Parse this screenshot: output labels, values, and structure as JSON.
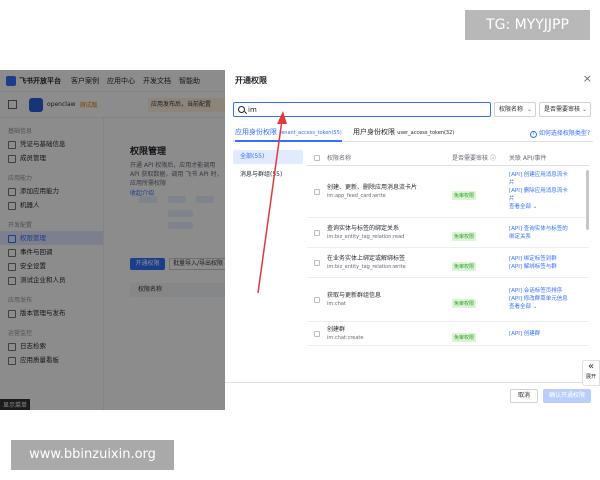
{
  "watermark_top": "TG: MYYJJPP",
  "watermark_bottom": "www.bbinzuixin.org",
  "bg": {
    "brand": "飞书开放平台",
    "nav": [
      "客户案例",
      "应用中心",
      "开发文档",
      "智能助"
    ],
    "app_name": "openclaw",
    "app_tag": "测试版",
    "warn": "应用发布后，当前配置",
    "side_groups": [
      {
        "title": "基础信息",
        "items": [
          "凭证与基础信息",
          "成员管理"
        ]
      },
      {
        "title": "应用能力",
        "items": [
          "添加应用能力",
          "机器人"
        ]
      },
      {
        "title": "开发配置",
        "items": [
          "权限管理",
          "事件与回调",
          "安全设置",
          "测试企业和人员"
        ]
      },
      {
        "title": "应用发布",
        "items": [
          "版本管理与发布"
        ]
      },
      {
        "title": "运营监控",
        "items": [
          "日志检索",
          "应用质量看板"
        ]
      }
    ],
    "active_item": "权限管理",
    "main_title": "权限管理",
    "main_desc": "开通 API 权限后，应用才能调用 API 获取数据，调用 飞书 API 时，应用所需权限",
    "main_link": "收起介绍",
    "main_btn": "开通权限",
    "main_btn2": "批量导入/导出权限",
    "table_header": "权限名称",
    "footer_badge": "显示菜单"
  },
  "modal": {
    "title": "开通权限",
    "search_value": "im",
    "select1": "权限名称",
    "select2": "是否需要审核",
    "tabs": [
      {
        "label": "应用身份权限",
        "sub": "tenant_access_token(55)",
        "active": true
      },
      {
        "label": "用户身份权限",
        "sub": "user_access_token(32)",
        "active": false
      }
    ],
    "help": "如何选择权限类型?",
    "categories": [
      {
        "label": "全部(55)",
        "active": true
      },
      {
        "label": "消息与群组(55)",
        "active": false
      }
    ],
    "columns": [
      "权限名称",
      "是否需要审核",
      "关联 API/事件"
    ],
    "rows": [
      {
        "name": "创建、更新、删除应用消息流卡片",
        "code": "im:app_feed_card:write",
        "review": "免审权限",
        "events": [
          "[API] 创建应用消息流卡",
          "片",
          "[API] 删除应用消息流卡",
          "片"
        ],
        "more": "查看全部"
      },
      {
        "name": "查询实体与标签的绑定关系",
        "code": "im:biz_entity_tag_relation:read",
        "review": "免审权限",
        "events": [
          "[API] 查询实体与标签的",
          "绑定关系"
        ],
        "more": ""
      },
      {
        "name": "在业务实体上绑定或解绑标签",
        "code": "im:biz_entity_tag_relation:write",
        "review": "免审权限",
        "events": [
          "[API] 绑定标签到群",
          "[API] 解绑标签与群"
        ],
        "more": ""
      },
      {
        "name": "获取与更新群组信息",
        "code": "im:chat",
        "review": "免审权限",
        "events": [
          "[API] 会话标签页排序",
          "[API] 修改群菜单元信息"
        ],
        "more": "查看全部"
      },
      {
        "name": "创建群",
        "code": "im:chat:create",
        "review": "免审权限",
        "events": [
          "[API] 创建群"
        ],
        "more": ""
      }
    ],
    "cancel": "取消",
    "confirm": "确认开通权限"
  },
  "expand_label": "展开",
  "colors": {
    "accent": "#3370ff",
    "badge_bg": "#d9f5d6",
    "badge_fg": "#2ea121",
    "arrow": "#e03a3a"
  }
}
